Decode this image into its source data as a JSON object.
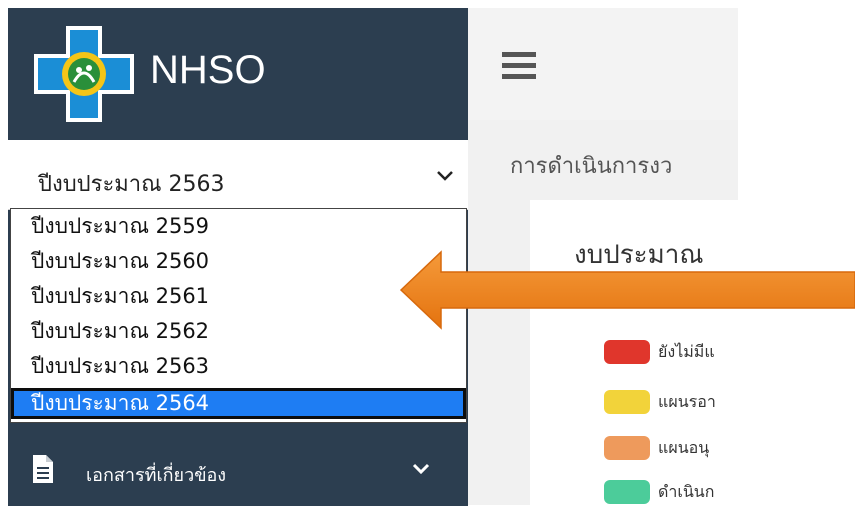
{
  "brand": {
    "name": "NHSO",
    "logo_icon": "nhso-cross-logo"
  },
  "year_select": {
    "value": "ปีงบประมาณ 2563",
    "options": [
      "ปีงบประมาณ 2559",
      "ปีงบประมาณ 2560",
      "ปีงบประมาณ 2561",
      "ปีงบประมาณ 2562",
      "ปีงบประมาณ 2563",
      "ปีงบประมาณ 2564"
    ],
    "highlighted": "ปีงบประมาณ 2564"
  },
  "sidebar": {
    "documents_label": "เอกสารที่เกี่ยวข้อง"
  },
  "header": {
    "menu_icon": "hamburger-icon"
  },
  "main": {
    "breadcrumb": "การดำเนินการงว",
    "card_title": "งบประมาณ",
    "legend": [
      {
        "label": "ยังไม่มีแ",
        "color": "#e0362c"
      },
      {
        "label": "แผนรอา",
        "color": "#f2d33a"
      },
      {
        "label": "แผนอนุ",
        "color": "#ee9a5c"
      },
      {
        "label": "ดำเนินก",
        "color": "#4ccc9a"
      }
    ]
  },
  "colors": {
    "sidebar": "#2c3e50",
    "selection": "#1e7df3",
    "arrow": "#ef7f1a"
  }
}
